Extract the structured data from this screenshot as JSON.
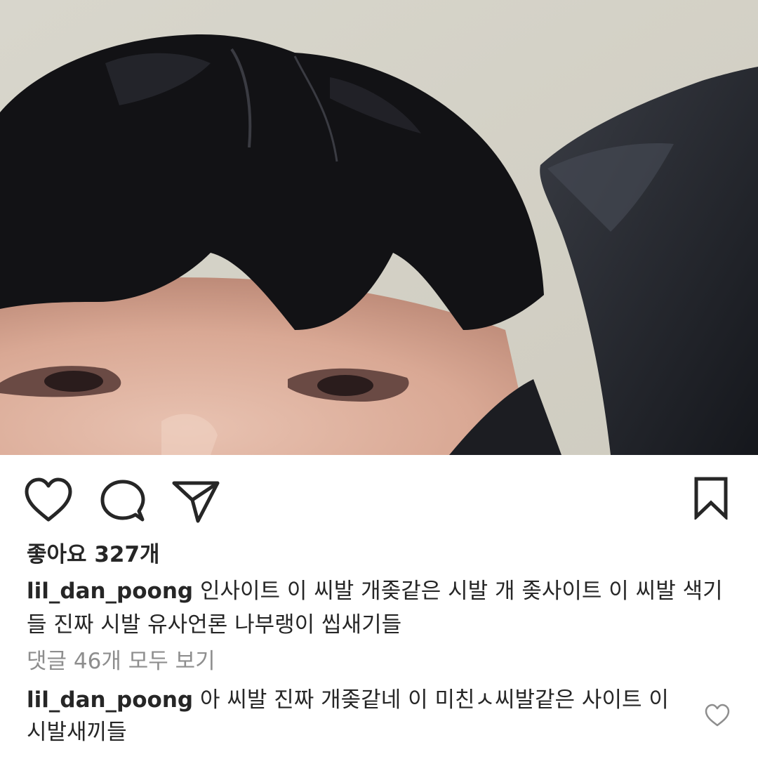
{
  "post": {
    "image_icon": "post-photo",
    "likes_text": "좋아요 327개",
    "caption": {
      "username": "lil_dan_poong",
      "text": "인사이트 이 씨발 개좆같은 시발 개 좆사이트 이 씨발 색기들 진짜 시발 유사언론 나부랭이 씹새기들"
    },
    "view_comments_text": "댓글 46개 모두 보기",
    "comment": {
      "username": "lil_dan_poong",
      "text": "아 씨발 진짜 개좆같네 이 미친ㅅ씨발같은 사이트 이 시발새끼들"
    }
  },
  "actions": {
    "like_icon": "heart-icon",
    "comment_icon": "comment-bubble-icon",
    "share_icon": "paper-plane-icon",
    "save_icon": "bookmark-icon",
    "comment_like_icon": "heart-icon"
  }
}
